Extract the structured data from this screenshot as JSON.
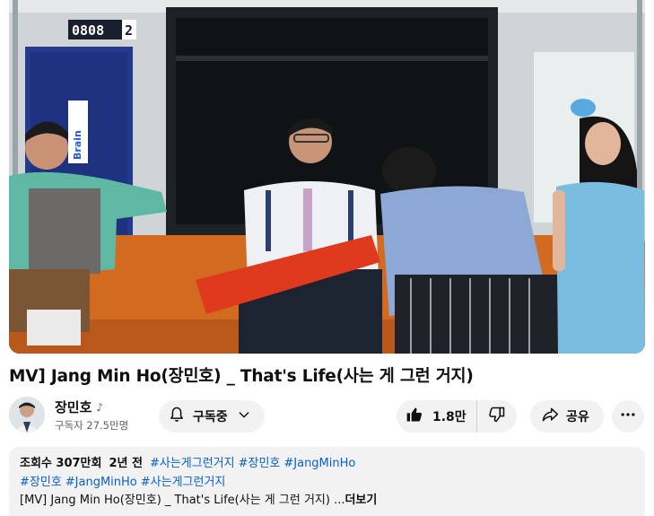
{
  "video": {
    "badge_number": "0808",
    "badge_digit": "2",
    "poster_text": "Brain"
  },
  "title": "MV] Jang Min Ho(장민호) _ That's Life(사는 게 그런 거지)",
  "channel": {
    "name": "장민호",
    "name_icon": "music-note-icon",
    "subscribers": "구독자 27.5만명"
  },
  "subscribe": {
    "label": "구독중"
  },
  "like": {
    "count": "1.8만"
  },
  "share": {
    "label": "공유"
  },
  "description": {
    "views": "조회수 307만회",
    "age": "2년 전",
    "tags_line1": [
      "#사는게그런거지",
      "#장민호",
      "#JangMinHo"
    ],
    "tags_line2": [
      "#장민호",
      "#JangMinHo",
      "#사는게그런거지"
    ],
    "text": "[MV] Jang Min Ho(장민호) _ That's Life(사는 게 그런 거지) ...",
    "more_label": "더보기"
  },
  "colors": {
    "link": "#065fd4",
    "pill_bg": "#f2f2f2",
    "seat_orange": "#d26a1f"
  }
}
